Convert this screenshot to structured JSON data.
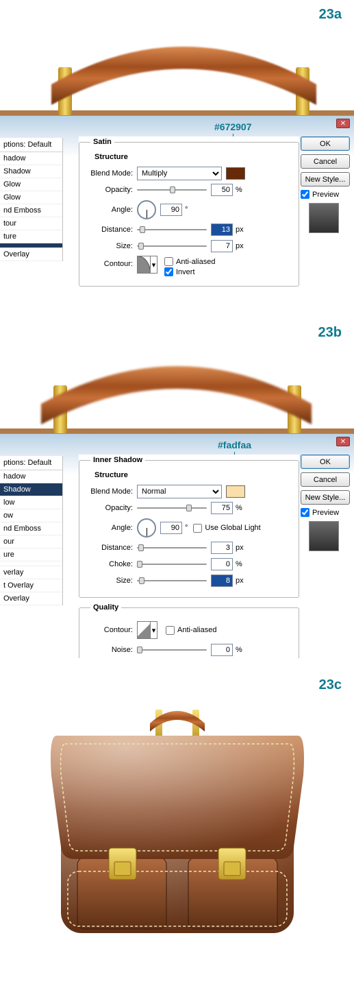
{
  "step_labels": {
    "a": "23a",
    "b": "23b",
    "c": "23c"
  },
  "annotations": {
    "a_color": "#672907",
    "b_color": "#fadfaa"
  },
  "buttons": {
    "ok": "OK",
    "cancel": "Cancel",
    "new_style": "New Style..."
  },
  "preview_label": "Preview",
  "style_list_header": "ptions: Default",
  "dialog_a": {
    "legend": "Satin",
    "structure_label": "Structure",
    "styles": [
      "hadow",
      "Shadow",
      "Glow",
      "Glow",
      "nd Emboss",
      "tour",
      "ture",
      "",
      "Overlay"
    ],
    "selected_index": -1,
    "blend_mode_label": "Blend Mode:",
    "blend_mode_value": "Multiply",
    "swatch_hex": "#672907",
    "opacity_label": "Opacity:",
    "opacity_value": "50",
    "opacity_unit": "%",
    "angle_label": "Angle:",
    "angle_value": "90",
    "angle_unit": "°",
    "distance_label": "Distance:",
    "distance_value": "13",
    "distance_unit": "px",
    "size_label": "Size:",
    "size_value": "7",
    "size_unit": "px",
    "contour_label": "Contour:",
    "anti_aliased_label": "Anti-aliased",
    "anti_aliased_checked": false,
    "invert_label": "Invert",
    "invert_checked": true
  },
  "dialog_b": {
    "legend": "Inner Shadow",
    "structure_label": "Structure",
    "styles": [
      "hadow",
      "Shadow",
      "low",
      "ow",
      "nd Emboss",
      "our",
      "ure",
      "",
      "verlay",
      "t Overlay",
      "Overlay"
    ],
    "selected_index": 1,
    "blend_mode_label": "Blend Mode:",
    "blend_mode_value": "Normal",
    "swatch_hex": "#fadfaa",
    "opacity_label": "Opacity:",
    "opacity_value": "75",
    "opacity_unit": "%",
    "angle_label": "Angle:",
    "angle_value": "90",
    "angle_unit": "°",
    "use_global_label": "Use Global Light",
    "use_global_checked": false,
    "distance_label": "Distance:",
    "distance_value": "3",
    "distance_unit": "px",
    "choke_label": "Choke:",
    "choke_value": "0",
    "choke_unit": "%",
    "size_label": "Size:",
    "size_value": "8",
    "size_unit": "px",
    "quality_legend": "Quality",
    "contour_label": "Contour:",
    "anti_aliased_label": "Anti-aliased",
    "anti_aliased_checked": false,
    "noise_label": "Noise:",
    "noise_value": "0",
    "noise_unit": "%"
  }
}
